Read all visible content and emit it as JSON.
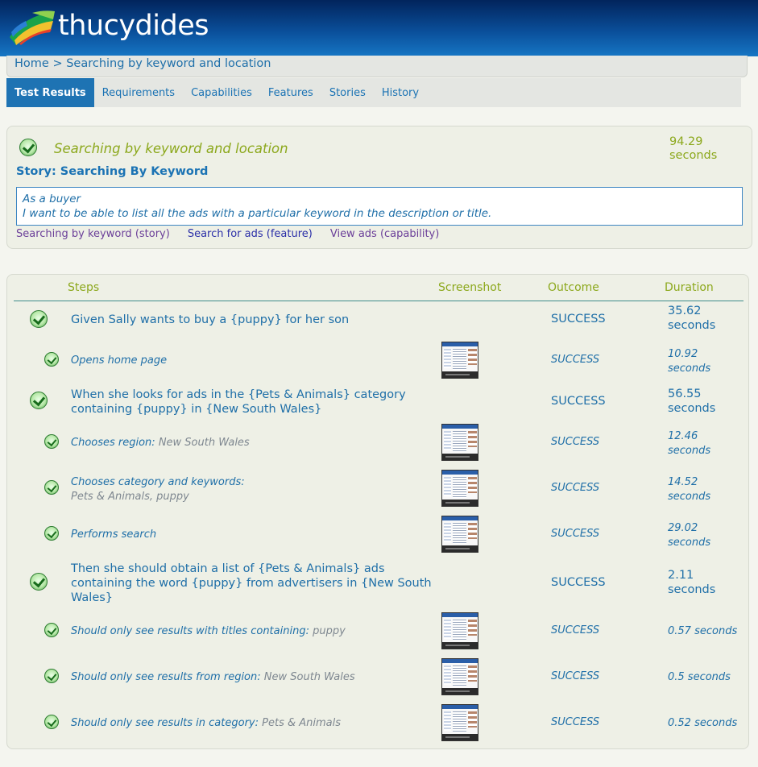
{
  "app": {
    "title": "thucydides"
  },
  "breadcrumb": {
    "home": "Home",
    "sep": ">",
    "current": "Searching by keyword and location"
  },
  "tabs": [
    "Test Results",
    "Requirements",
    "Capabilities",
    "Features",
    "Stories",
    "History"
  ],
  "story": {
    "title": "Searching by keyword and location",
    "duration_value": "94.29",
    "duration_unit": "seconds",
    "name": "Story: Searching By Keyword",
    "narrative_line1": "As a buyer",
    "narrative_line2": "I want to be able to list all the ads with a particular keyword in the description or title.",
    "tags": [
      {
        "label": "Searching by keyword (story)",
        "color": "#6b3f99"
      },
      {
        "label": "Search for ads (feature)",
        "color": "#2b2fa8"
      },
      {
        "label": "View ads (capability)",
        "color": "#6b3f99"
      }
    ]
  },
  "steps_table": {
    "headers": {
      "steps": "Steps",
      "screenshot": "Screenshot",
      "outcome": "Outcome",
      "duration": "Duration"
    },
    "rows": [
      {
        "level": "top",
        "lines": [
          "Given Sally wants to buy a {puppy} for her son"
        ],
        "arg": "",
        "has_screenshot": false,
        "outcome": "SUCCESS",
        "duration": [
          "35.62",
          "seconds"
        ]
      },
      {
        "level": "sub",
        "lines": [
          "Opens home page"
        ],
        "arg": "",
        "has_screenshot": true,
        "outcome": "SUCCESS",
        "duration": [
          "10.92",
          "seconds"
        ]
      },
      {
        "level": "top",
        "lines": [
          "When she looks for ads in the {Pets & Animals} category",
          "containing {puppy} in {New South Wales}"
        ],
        "arg": "",
        "has_screenshot": false,
        "outcome": "SUCCESS",
        "duration": [
          "56.55",
          "seconds"
        ]
      },
      {
        "level": "sub",
        "lines": [
          "Chooses region: "
        ],
        "arg": "New South Wales",
        "arg_inline": true,
        "has_screenshot": true,
        "outcome": "SUCCESS",
        "duration": [
          "12.46",
          "seconds"
        ]
      },
      {
        "level": "sub",
        "lines": [
          "Chooses category and keywords:"
        ],
        "arg": "Pets & Animals, puppy",
        "arg_inline": false,
        "has_screenshot": true,
        "outcome": "SUCCESS",
        "duration": [
          "14.52",
          "seconds"
        ]
      },
      {
        "level": "sub",
        "lines": [
          "Performs search"
        ],
        "arg": "",
        "has_screenshot": true,
        "outcome": "SUCCESS",
        "duration": [
          "29.02",
          "seconds"
        ]
      },
      {
        "level": "top",
        "lines": [
          "Then she should obtain a list of {Pets & Animals} ads",
          "containing the word {puppy} from advertisers in {New South",
          "Wales}"
        ],
        "arg": "",
        "has_screenshot": false,
        "outcome": "SUCCESS",
        "duration": [
          "2.11",
          "seconds"
        ]
      },
      {
        "level": "sub",
        "lines": [
          "Should only see results with titles containing: "
        ],
        "arg": "puppy",
        "arg_inline": true,
        "has_screenshot": true,
        "outcome": "SUCCESS",
        "duration": [
          "0.57 seconds"
        ]
      },
      {
        "level": "sub",
        "lines": [
          "Should only see results from region: "
        ],
        "arg": "New South Wales",
        "arg_inline": true,
        "has_screenshot": true,
        "outcome": "SUCCESS",
        "duration": [
          "0.5 seconds"
        ]
      },
      {
        "level": "sub",
        "lines": [
          "Should only see results in category: "
        ],
        "arg": "Pets & Animals",
        "arg_inline": true,
        "has_screenshot": true,
        "outcome": "SUCCESS",
        "duration": [
          "0.52 seconds"
        ]
      }
    ]
  }
}
